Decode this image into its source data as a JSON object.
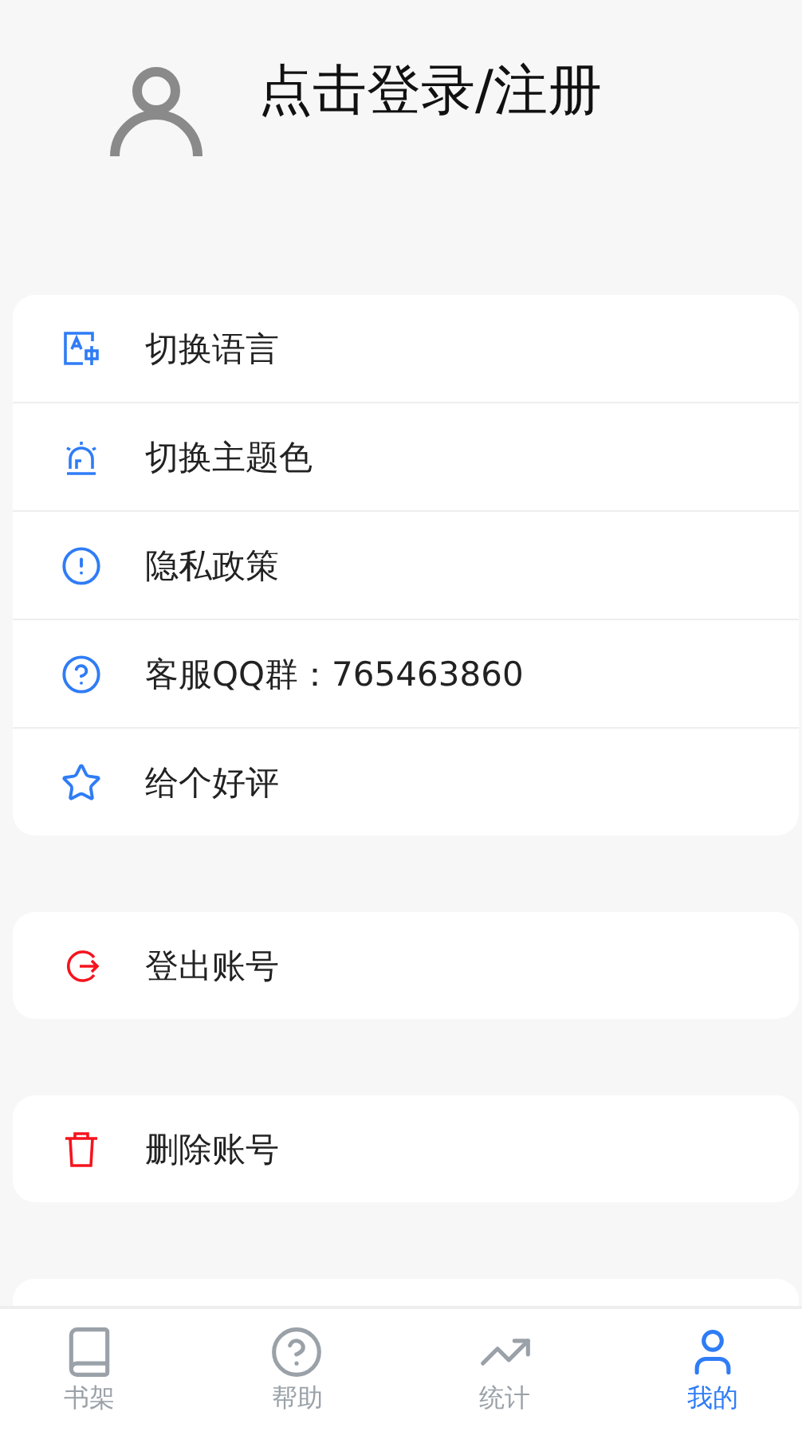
{
  "profile": {
    "title": "点击登录/注册"
  },
  "menu_groups": [
    {
      "items": [
        {
          "kind": "language",
          "label": "切换语言",
          "color": "#2f7cf6"
        },
        {
          "kind": "theme",
          "label": "切换主题色",
          "color": "#2f7cf6"
        },
        {
          "kind": "privacy",
          "label": "隐私政策",
          "color": "#2f7cf6"
        },
        {
          "kind": "support",
          "label": "客服QQ群：765463860",
          "color": "#2f7cf6"
        },
        {
          "kind": "rate",
          "label": "给个好评",
          "color": "#2f7cf6"
        }
      ]
    },
    {
      "items": [
        {
          "kind": "logout",
          "label": "登出账号",
          "color": "#f5141e"
        }
      ]
    },
    {
      "items": [
        {
          "kind": "delete",
          "label": "删除账号",
          "color": "#f5141e"
        }
      ]
    }
  ],
  "tab_bar": [
    {
      "kind": "bookshelf",
      "label": "书架",
      "selected": false
    },
    {
      "kind": "help",
      "label": "帮助",
      "selected": false
    },
    {
      "kind": "stats",
      "label": "统计",
      "selected": false
    },
    {
      "kind": "me",
      "label": "我的",
      "selected": true
    }
  ]
}
